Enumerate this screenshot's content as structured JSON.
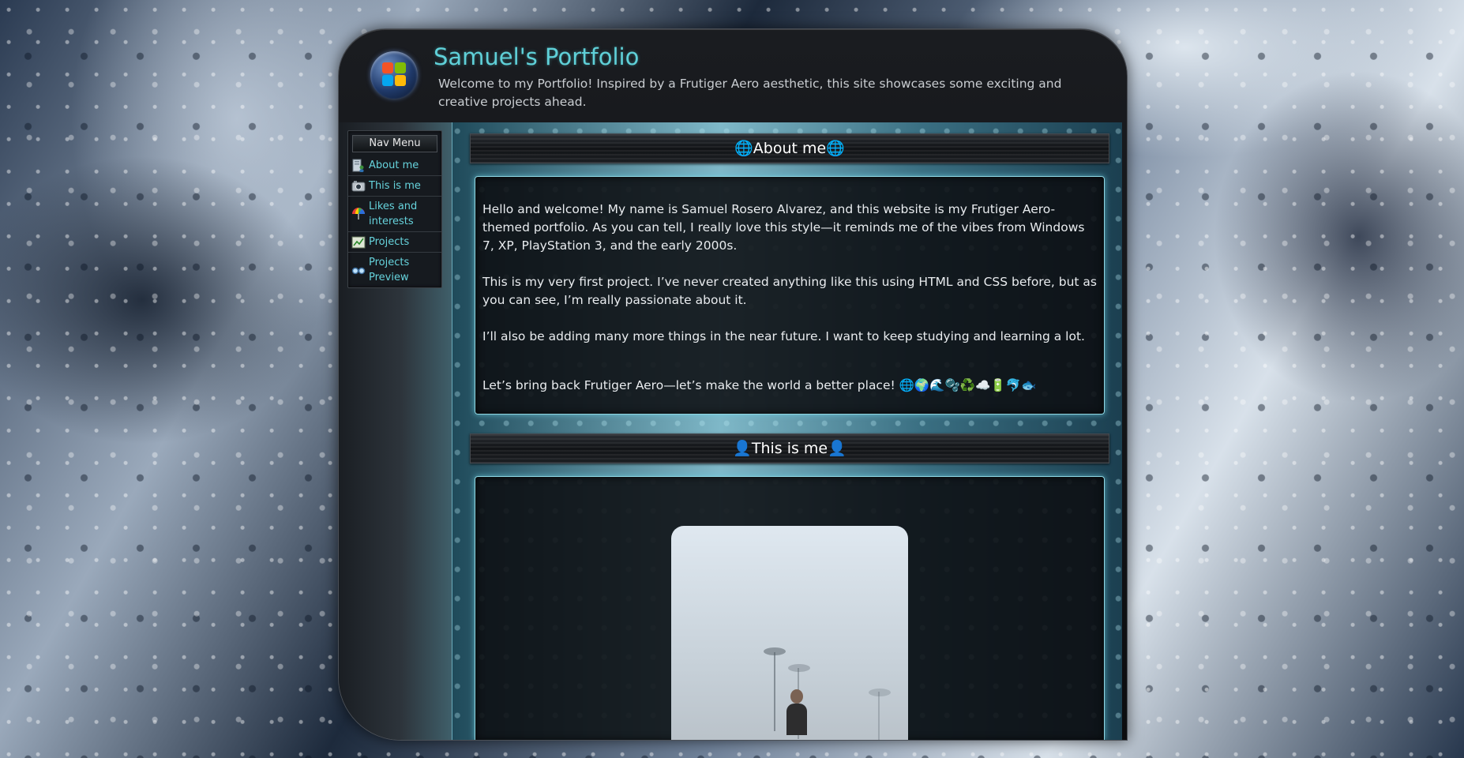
{
  "header": {
    "title": "Samuel's Portfolio",
    "subtitle": "Welcome to my Portfolio! Inspired by a Frutiger Aero aesthetic, this site showcases some exciting and creative projects ahead.",
    "logo_icon": "windows-orb-icon"
  },
  "nav": {
    "title": "Nav Menu",
    "items": [
      {
        "label": "About me",
        "icon": "user-document-icon"
      },
      {
        "label": "This is me",
        "icon": "photo-camera-icon"
      },
      {
        "label": "Likes and interests",
        "icon": "colorful-umbrella-icon"
      },
      {
        "label": "Projects",
        "icon": "chart-icon"
      },
      {
        "label": "Projects Preview",
        "icon": "glasses-icon"
      }
    ]
  },
  "sections": {
    "about": {
      "heading": "🌐About me🌐",
      "p1": "Hello and welcome! My name is Samuel Rosero Alvarez, and this website is my Frutiger Aero-themed portfolio. As you can tell, I really love this style—it reminds me of the vibes from Windows 7, XP, PlayStation 3, and the early 2000s.",
      "p2": "This is my very first project. I’ve never created anything like this using HTML and CSS before, but as you can see, I’m really passionate about it.",
      "p3": "I’ll also be adding many more things in the near future. I want to keep studying and learning a lot.",
      "p4": "Let’s bring back Frutiger Aero—let’s make the world a better place! 🌐🌍🌊🫧♻️☁️🔋🐬🐟"
    },
    "this_is_me": {
      "heading": "👤This is me👤"
    }
  },
  "colors": {
    "accent": "#5fd0d8",
    "nav_link": "#66d3dc",
    "card_glow": "#8fd6e2"
  }
}
